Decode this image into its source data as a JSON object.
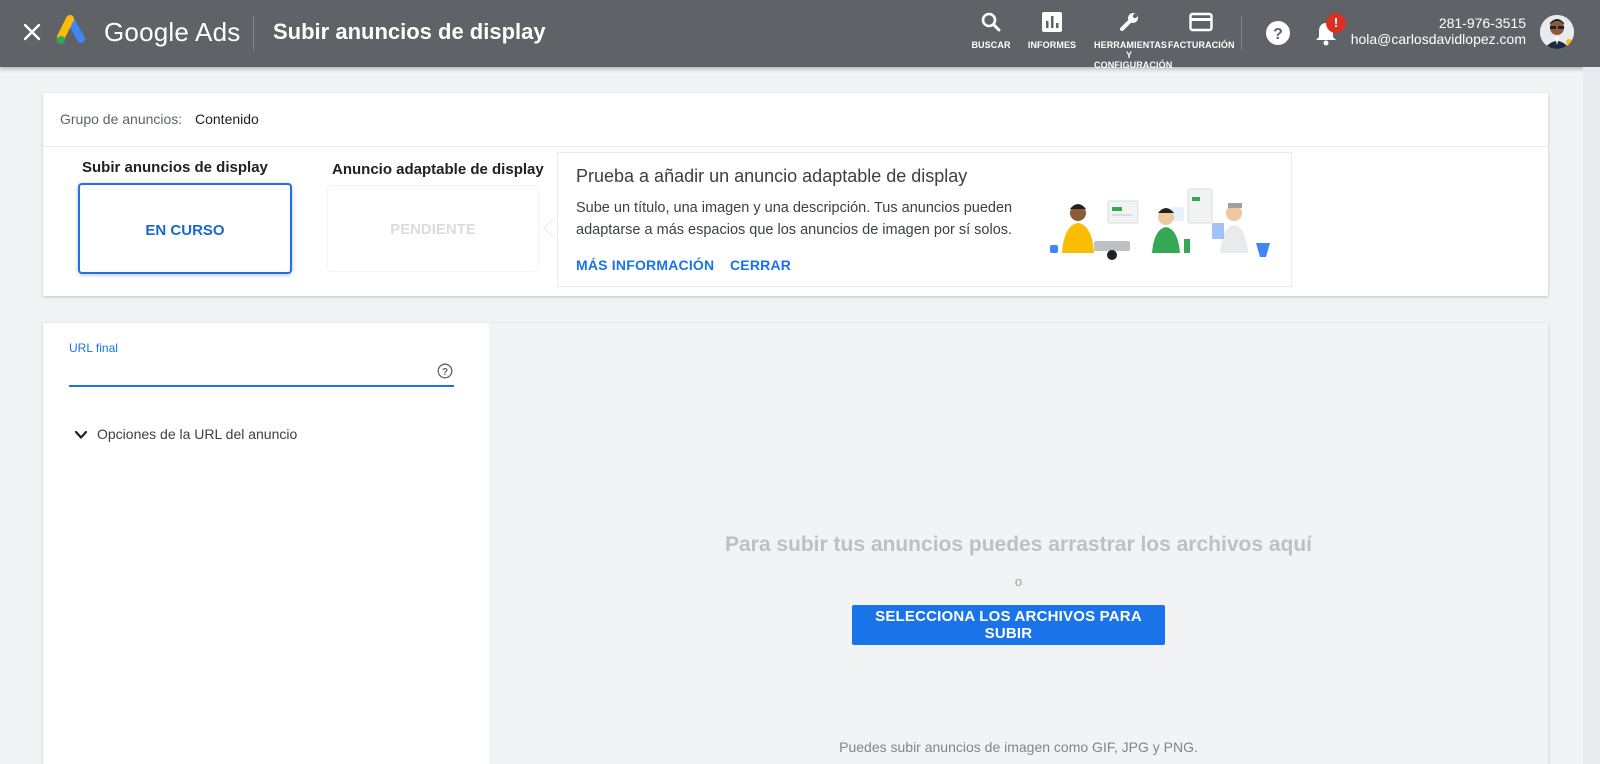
{
  "header": {
    "brand": "Google Ads",
    "title": "Subir anuncios de display",
    "tools": [
      {
        "label": "BUSCAR",
        "icon": "search-icon"
      },
      {
        "label": "INFORMES",
        "icon": "reports-icon"
      },
      {
        "label": "HERRAMIENTAS Y CONFIGURACIÓN",
        "icon": "wrench-icon"
      },
      {
        "label": "FACTURACIÓN",
        "icon": "billing-icon"
      }
    ],
    "notification_badge": "!",
    "account_phone": "281-976-3515",
    "account_email": "hola@carlosdavidlopez.com"
  },
  "ad_group": {
    "label": "Grupo de anuncios:",
    "value": "Contenido"
  },
  "steps": [
    {
      "title": "Subir anuncios de display",
      "status": "EN CURSO"
    },
    {
      "title": "Anuncio adaptable de display",
      "status": "PENDIENTE"
    }
  ],
  "promo": {
    "title": "Prueba a añadir un anuncio adaptable de display",
    "description": "Sube un título, una imagen y una descripción. Tus anuncios pueden adaptarse a más espacios que los anuncios de imagen por sí solos.",
    "more_info": "MÁS INFORMACIÓN",
    "close": "CERRAR"
  },
  "form": {
    "url_label": "URL final",
    "url_value": "",
    "url_options": "Opciones de la URL del anuncio"
  },
  "upload": {
    "drop_text": "Para subir tus anuncios puedes arrastrar los archivos aquí",
    "or_text": "o",
    "button_label": "SELECCIONA LOS ARCHIVOS PARA SUBIR",
    "hint": "Puedes subir anuncios de imagen como GIF, JPG y PNG."
  },
  "colors": {
    "topbar": "#5f6368",
    "accent": "#1a73e8",
    "alert": "#d93025"
  }
}
